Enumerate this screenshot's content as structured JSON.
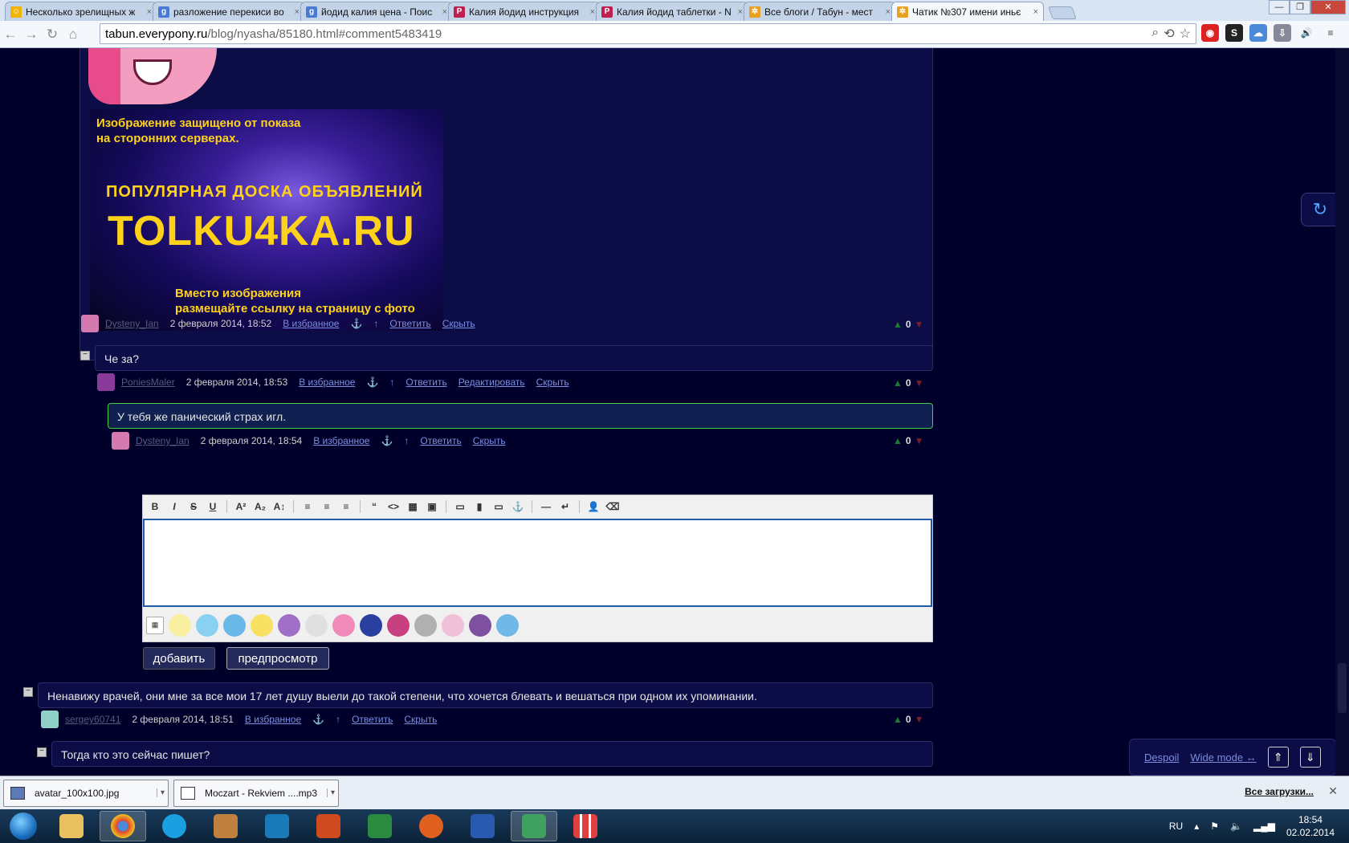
{
  "browser": {
    "tabs": [
      {
        "title": "Несколько зрелищных ж",
        "icon": "smiley-icon",
        "color": "#f0b400",
        "glyph": "☺"
      },
      {
        "title": "разложение перекиси во",
        "icon": "google-icon",
        "color": "#4a7bd4",
        "glyph": "g"
      },
      {
        "title": "йодид калия цена - Поис",
        "icon": "google-icon",
        "color": "#4a7bd4",
        "glyph": "g"
      },
      {
        "title": "Калия йодид инструкция",
        "icon": "p-icon",
        "color": "#c02050",
        "glyph": "P"
      },
      {
        "title": "Калия йодид таблетки - N",
        "icon": "p-icon",
        "color": "#c02050",
        "glyph": "P"
      },
      {
        "title": "Все блоги / Табун - мест",
        "icon": "tabun-icon",
        "color": "#e8a020",
        "glyph": "✲"
      },
      {
        "title": "Чатик №307 имени иньє",
        "icon": "tabun-icon",
        "color": "#e8a020",
        "glyph": "✲"
      }
    ],
    "tab_close": "×",
    "url_host": "tabun.everypony.ru",
    "url_path": "/blog/nyasha/85180.html#comment5483419"
  },
  "ad": {
    "protected_line1": "Изображение защищено от показа",
    "protected_line2": "на сторонних серверах.",
    "board": "ПОПУЛЯРНАЯ ДОСКА ОБЪЯВЛЕНИЙ",
    "site": "TOLKU4KA.RU",
    "hint_line1": "Вместо изображения",
    "hint_line2": "размещайте ссылку на страницу с фото"
  },
  "comments": [
    {
      "author": "Dysteny_Ian",
      "date": "2 февраля 2014, 18:52",
      "fav": "В избранное",
      "anchor": "⚓",
      "up": "↑",
      "reply": "Ответить",
      "hide": "Скрыть",
      "score": "0",
      "avatar_color": "#d57ab0"
    },
    {
      "text": "Че за?",
      "author": "PoniesMaler",
      "date": "2 февраля 2014, 18:53",
      "fav": "В избранное",
      "anchor": "⚓",
      "up": "↑",
      "reply": "Ответить",
      "edit": "Редактировать",
      "hide": "Скрыть",
      "score": "0",
      "avatar_color": "#8a3a9a"
    },
    {
      "text": "У тебя же панический страх игл.",
      "author": "Dysteny_Ian",
      "date": "2 февраля 2014, 18:54",
      "fav": "В избранное",
      "anchor": "⚓",
      "up": "↑",
      "reply": "Ответить",
      "hide": "Скрыть",
      "score": "0",
      "avatar_color": "#d57ab0"
    },
    {
      "text": "Ненавижу врачей, они мне за все мои 17 лет душу выели до такой степени, что хочется блевать и вешаться при одном их упоминании.",
      "author": "sergey60741",
      "date": "2 февраля 2014, 18:51",
      "fav": "В избранное",
      "anchor": "⚓",
      "up": "↑",
      "reply": "Ответить",
      "hide": "Скрыть",
      "score": "0",
      "avatar_color": "#8fd0c8"
    },
    {
      "text": "Тогда кто это сейчас пишет?"
    }
  ],
  "editor": {
    "submit": "добавить",
    "preview": "предпросмотр"
  },
  "float_panel": {
    "despoil": "Despoil",
    "wide_mode": "Wide mode ↔"
  },
  "downloads": {
    "items": [
      "avatar_100x100.jpg",
      "Moczart - Rekviem ....mp3"
    ],
    "all": "Все загрузки..."
  },
  "taskbar": {
    "lang": "RU",
    "time": "18:54",
    "date": "02.02.2014"
  }
}
